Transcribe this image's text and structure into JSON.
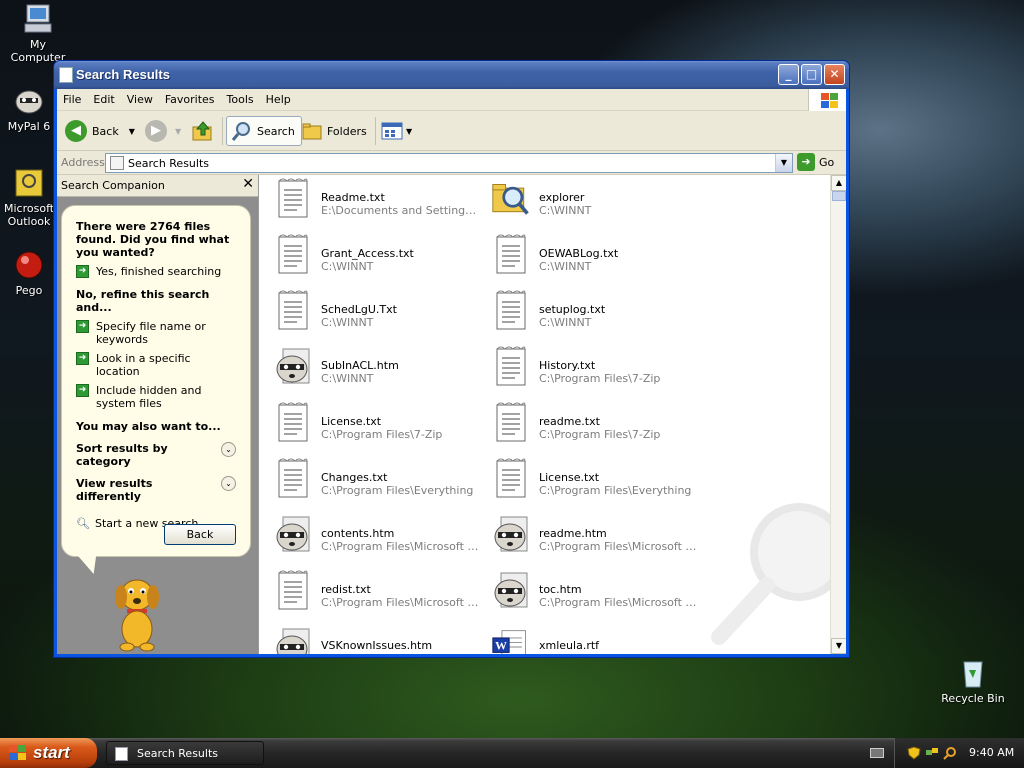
{
  "desktop": {
    "icons": [
      {
        "label": "My Computer"
      },
      {
        "label": "MyPal 6"
      },
      {
        "label": "Microsoft Outlook"
      },
      {
        "label": "Pego"
      },
      {
        "label": "Recycle Bin"
      }
    ]
  },
  "window": {
    "title": "Search Results",
    "menu": [
      "File",
      "Edit",
      "View",
      "Favorites",
      "Tools",
      "Help"
    ],
    "toolbar": {
      "back": "Back",
      "search": "Search",
      "folders": "Folders"
    },
    "address": {
      "label": "Address",
      "value": "Search Results",
      "go": "Go"
    }
  },
  "companion": {
    "title": "Search Companion",
    "found_text": "There were 2764 files found. Did you find what you wanted?",
    "yes_link": "Yes, finished searching",
    "refine_heading": "No, refine this search and...",
    "refine_links": [
      "Specify file name or keywords",
      "Look in a specific location",
      "Include hidden and system files"
    ],
    "also_heading": "You may also want to...",
    "sort_label": "Sort results by category",
    "view_label": "View results differently",
    "new_search": "Start a new search",
    "back_button": "Back"
  },
  "results": [
    {
      "name": "Readme.txt",
      "path": "E:\\Documents and Settings\\v...",
      "icon": "text-file"
    },
    {
      "name": "explorer",
      "path": "C:\\WINNT",
      "icon": "explorer-search"
    },
    {
      "name": "Grant_Access.txt",
      "path": "C:\\WINNT",
      "icon": "text-file"
    },
    {
      "name": "OEWABLog.txt",
      "path": "C:\\WINNT",
      "icon": "text-file"
    },
    {
      "name": "SchedLgU.Txt",
      "path": "C:\\WINNT",
      "icon": "text-file"
    },
    {
      "name": "setuplog.txt",
      "path": "C:\\WINNT",
      "icon": "text-file"
    },
    {
      "name": "SubInACL.htm",
      "path": "C:\\WINNT",
      "icon": "htm-file"
    },
    {
      "name": "History.txt",
      "path": "C:\\Program Files\\7-Zip",
      "icon": "text-file"
    },
    {
      "name": "License.txt",
      "path": "C:\\Program Files\\7-Zip",
      "icon": "text-file"
    },
    {
      "name": "readme.txt",
      "path": "C:\\Program Files\\7-Zip",
      "icon": "text-file"
    },
    {
      "name": "Changes.txt",
      "path": "C:\\Program Files\\Everything",
      "icon": "text-file"
    },
    {
      "name": "License.txt",
      "path": "C:\\Program Files\\Everything",
      "icon": "text-file"
    },
    {
      "name": "contents.htm",
      "path": "C:\\Program Files\\Microsoft Vis...",
      "icon": "htm-file"
    },
    {
      "name": "readme.htm",
      "path": "C:\\Program Files\\Microsoft Vis...",
      "icon": "htm-file"
    },
    {
      "name": "redist.txt",
      "path": "C:\\Program Files\\Microsoft Vis...",
      "icon": "text-file"
    },
    {
      "name": "toc.htm",
      "path": "C:\\Program Files\\Microsoft Vis...",
      "icon": "htm-file"
    },
    {
      "name": "VSKnownIssues.htm",
      "path": "",
      "icon": "htm-file"
    },
    {
      "name": "xmleula.rtf",
      "path": "",
      "icon": "word-file"
    }
  ],
  "taskbar": {
    "start": "start",
    "task": "Search Results",
    "clock": "9:40 AM"
  }
}
